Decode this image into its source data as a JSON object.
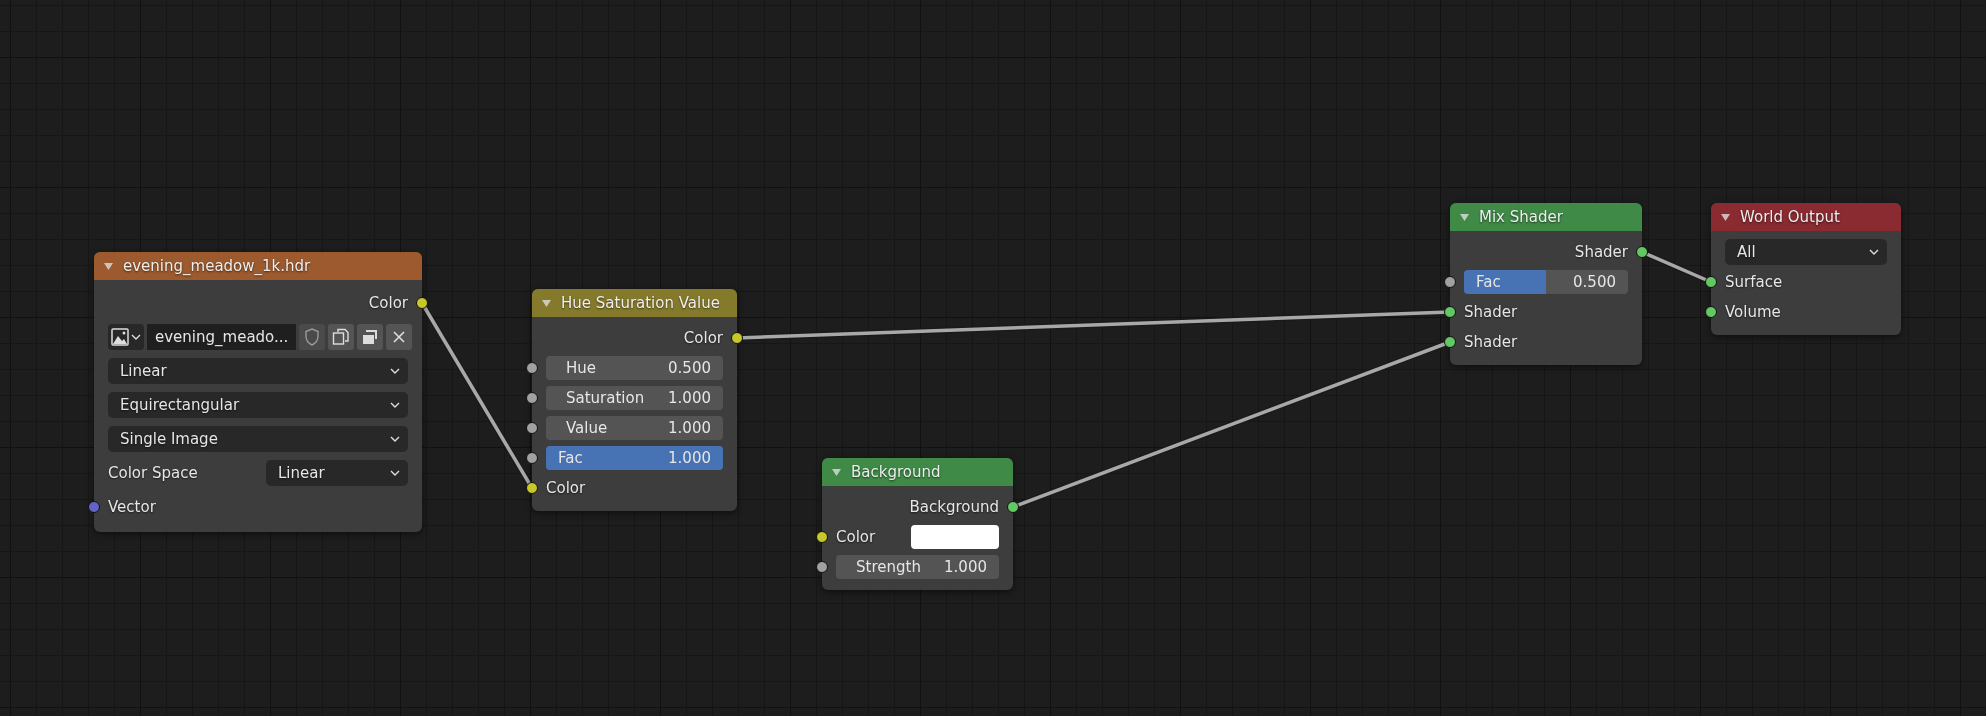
{
  "nodes": [
    {
      "title": "evening_meadow_1k.hdr",
      "color": "#9c5a2e",
      "rows": [
        {
          "kind": "output",
          "label": "Color",
          "color": "#c7c729"
        },
        {
          "kind": "image",
          "value": "evening_meado..."
        },
        {
          "kind": "dropdown",
          "value": "Linear"
        },
        {
          "kind": "dropdown",
          "value": "Equirectangular"
        },
        {
          "kind": "dropdown",
          "value": "Single Image"
        },
        {
          "kind": "labeled_dropdown",
          "label": "Color Space",
          "value": "Linear"
        },
        {
          "kind": "input",
          "label": "Vector",
          "color": "#6363c7"
        }
      ]
    },
    {
      "title": "Hue Saturation Value",
      "color": "#857a2c",
      "rows": [
        {
          "kind": "output",
          "label": "Color",
          "color": "#c7c729"
        },
        {
          "kind": "number",
          "label": "Hue",
          "value": "0.500",
          "color": "#a1a1a1"
        },
        {
          "kind": "number",
          "label": "Saturation",
          "value": "1.000",
          "color": "#a1a1a1"
        },
        {
          "kind": "number",
          "label": "Value",
          "value": "1.000",
          "color": "#a1a1a1"
        },
        {
          "kind": "slider",
          "label": "Fac",
          "value": "1.000",
          "level": 1,
          "color": "#a1a1a1"
        },
        {
          "kind": "input",
          "label": "Color",
          "color": "#c7c729"
        }
      ]
    },
    {
      "title": "Background",
      "color": "#3f8a46",
      "rows": [
        {
          "kind": "output",
          "label": "Background",
          "color": "#63c763"
        },
        {
          "kind": "color_input",
          "label": "Color",
          "swatch": {
            "color": "#ffffff"
          },
          "color": "#c7c729"
        },
        {
          "kind": "number",
          "label": "Strength",
          "value": "1.000",
          "color": "#a1a1a1"
        }
      ]
    },
    {
      "title": "Mix Shader",
      "color": "#3f8a46",
      "rows": [
        {
          "kind": "output",
          "label": "Shader",
          "color": "#63c763"
        },
        {
          "kind": "slider",
          "label": "Fac",
          "value": "0.500",
          "level": 0.5,
          "color": "#a1a1a1"
        },
        {
          "kind": "input",
          "label": "Shader",
          "color": "#63c763"
        },
        {
          "kind": "input",
          "label": "Shader",
          "color": "#63c763"
        }
      ]
    },
    {
      "title": "World Output",
      "color": "#8a2a31",
      "rows": [
        {
          "kind": "dropdown",
          "value": "All"
        },
        {
          "kind": "input",
          "label": "Surface",
          "color": "#63c763"
        },
        {
          "kind": "input",
          "label": "Volume",
          "color": "#63c763"
        }
      ]
    }
  ]
}
